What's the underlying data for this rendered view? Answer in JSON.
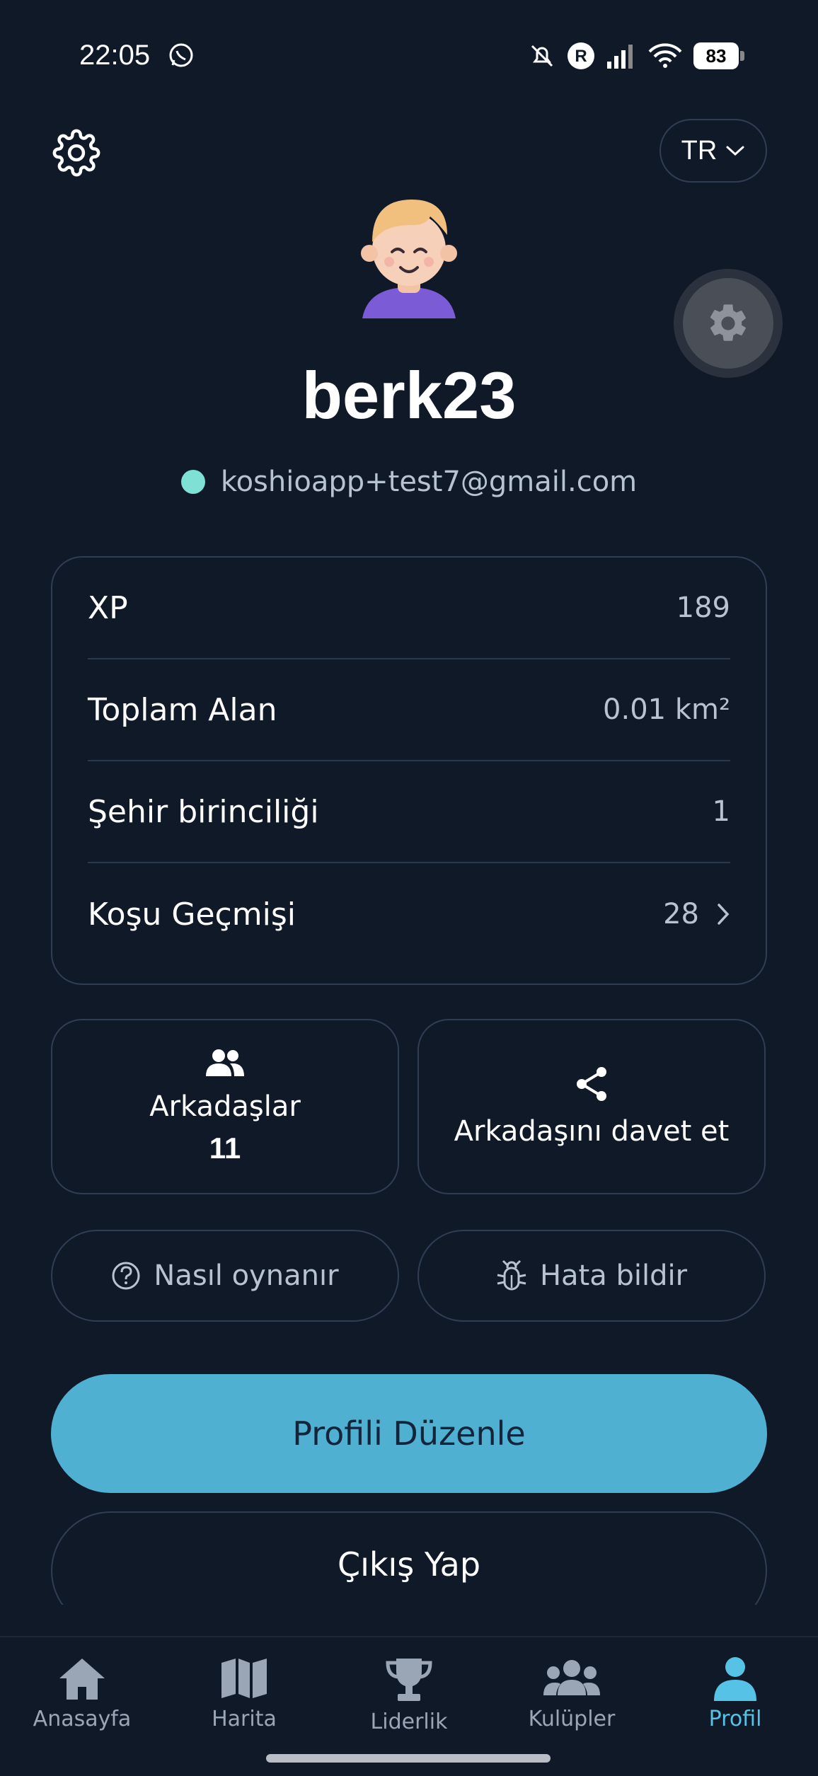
{
  "status_bar": {
    "time": "22:05",
    "battery": "83"
  },
  "header": {
    "language": "TR"
  },
  "profile": {
    "username": "berk23",
    "email": "koshioapp+test7@gmail.com",
    "status_color": "#7fe0d6"
  },
  "stats": [
    {
      "label": "XP",
      "value": "189"
    },
    {
      "label": "Toplam Alan",
      "value": "0.01 km²"
    },
    {
      "label": "Şehir birinciliği",
      "value": "1"
    },
    {
      "label": "Koşu Geçmişi",
      "value": "28"
    }
  ],
  "tiles": {
    "friends": {
      "label": "Arkadaşlar",
      "count": "11",
      "icon": "friends-icon"
    },
    "invite": {
      "label": "Arkadaşını davet et",
      "icon": "share-icon"
    }
  },
  "actions": {
    "how_to_play": "Nasıl oynanır",
    "report_bug": "Hata bildir",
    "edit_profile": "Profili Düzenle",
    "logout": "Çıkış Yap"
  },
  "nav": [
    {
      "label": "Anasayfa",
      "icon": "home-icon"
    },
    {
      "label": "Harita",
      "icon": "map-icon"
    },
    {
      "label": "Liderlik",
      "icon": "trophy-icon"
    },
    {
      "label": "Kulüpler",
      "icon": "group-icon"
    },
    {
      "label": "Profil",
      "icon": "user-icon",
      "active": true
    }
  ],
  "colors": {
    "background": "#101928",
    "accent": "#4fb0d2",
    "active_nav": "#56c3e6"
  }
}
